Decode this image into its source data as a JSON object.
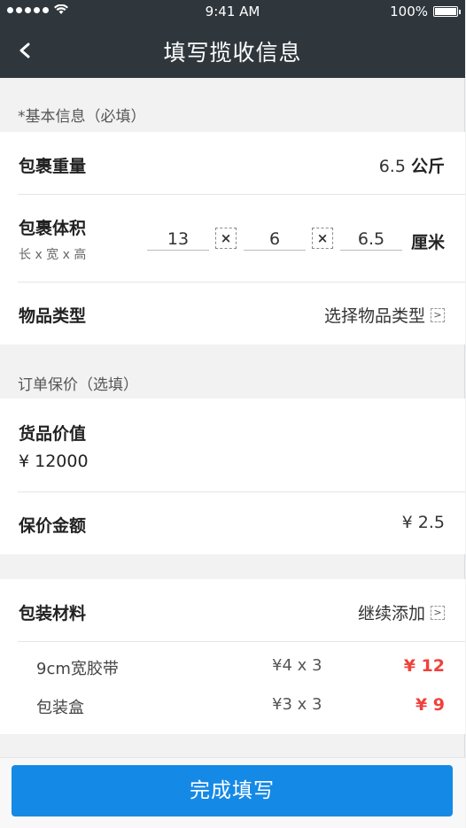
{
  "status_bar": {
    "time": "9:41 AM",
    "battery": "100%"
  },
  "nav": {
    "title": "填写揽收信息"
  },
  "basic": {
    "section_label": "*基本信息（必填）",
    "weight": {
      "label": "包裹重量",
      "value": "6.5",
      "unit": "公斤"
    },
    "volume": {
      "label": "包裹体积",
      "hint": "长 x 宽 x 高",
      "length": "13",
      "width": "6",
      "height": "6.5",
      "times": "×",
      "unit": "厘米"
    },
    "item_type": {
      "label": "物品类型",
      "value": "选择物品类型"
    }
  },
  "insurance": {
    "section_label": "订单保价（选填）",
    "goods_value": {
      "label": "货品价值",
      "value": "¥ 12000"
    },
    "premium": {
      "label": "保价金额",
      "value": "¥ 2.5"
    }
  },
  "packaging": {
    "label": "包装材料",
    "action": "继续添加",
    "items": [
      {
        "name": "9cm宽胶带",
        "qty": "¥4 x 3",
        "total": "¥ 12"
      },
      {
        "name": "包装盒",
        "qty": "¥3 x 3",
        "total": "¥ 9"
      }
    ]
  },
  "submit": {
    "label": "完成填写"
  },
  "colors": {
    "nav_bg": "#2f373d",
    "primary": "#1589e6",
    "price_red": "#f0413b"
  }
}
